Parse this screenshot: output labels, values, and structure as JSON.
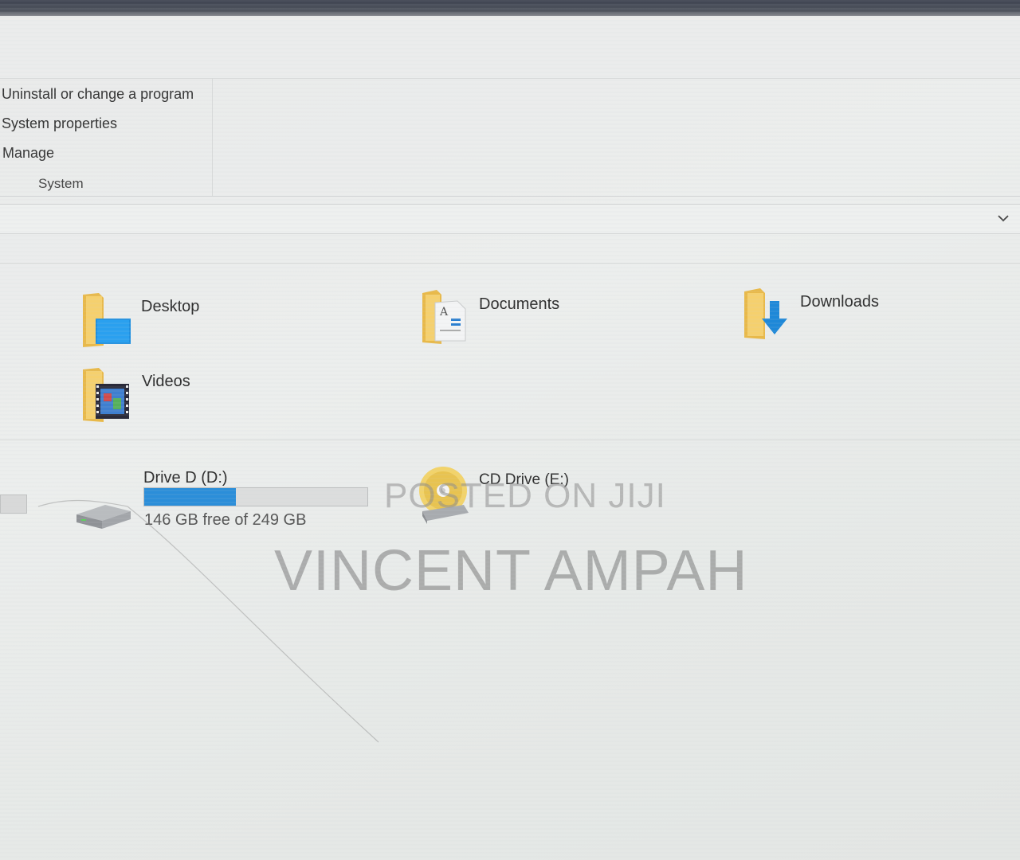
{
  "ribbon": {
    "items": [
      {
        "label": "Uninstall or change a program"
      },
      {
        "label": "System properties"
      },
      {
        "label": "Manage"
      }
    ],
    "group_label": "System"
  },
  "folders": [
    {
      "label": "Desktop",
      "icon": "desktop-folder-icon"
    },
    {
      "label": "Documents",
      "icon": "documents-folder-icon"
    },
    {
      "label": "Downloads",
      "icon": "downloads-folder-icon"
    },
    {
      "label": "Videos",
      "icon": "videos-folder-icon"
    }
  ],
  "drives": [
    {
      "label": "Drive D (D:)",
      "free_text": "146 GB free of 249 GB",
      "used_fraction": 0.41,
      "icon": "hard-drive-icon"
    },
    {
      "label": "CD Drive (E:)",
      "icon": "cd-drive-icon"
    }
  ],
  "watermark": {
    "line1": "POSTED ON JIJI",
    "line2": "VINCENT AMPAH"
  },
  "colors": {
    "accent": "#2b8ed9",
    "folder": "#f4c95d"
  }
}
